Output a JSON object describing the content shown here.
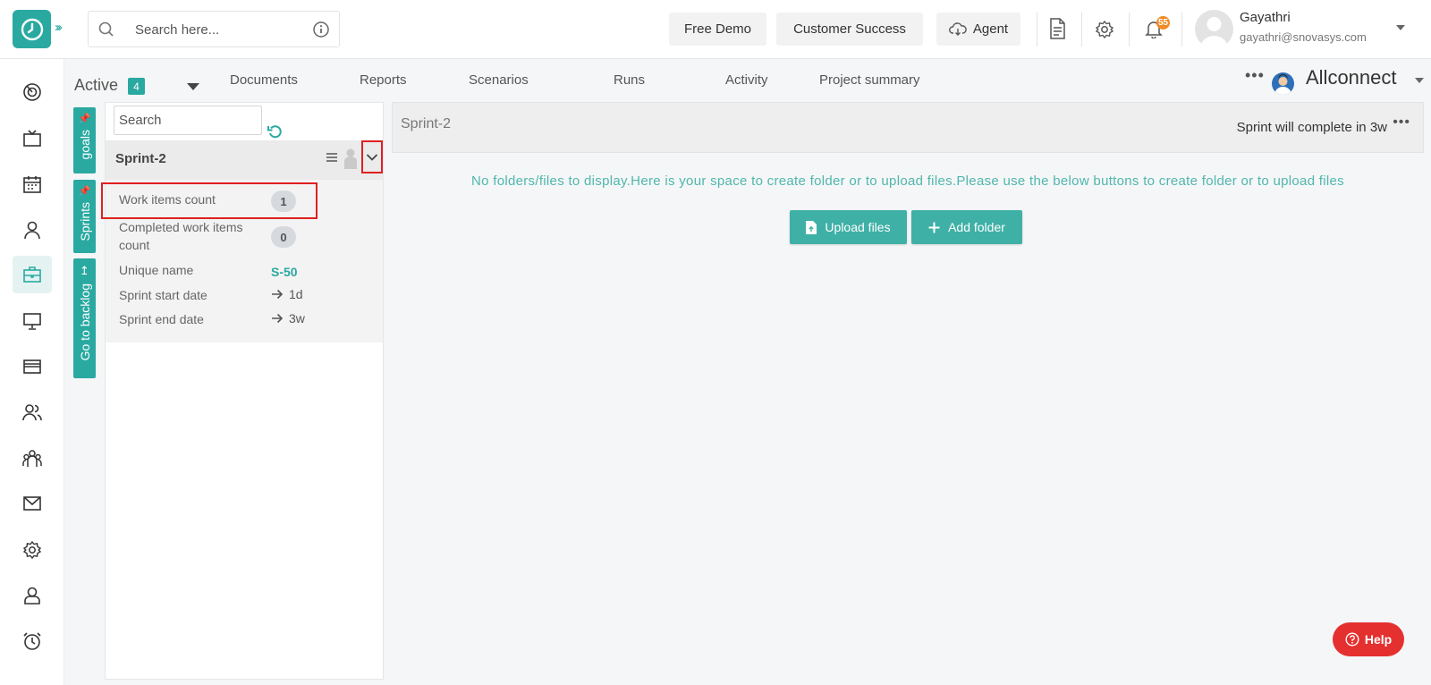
{
  "header": {
    "search_placeholder": "Search here...",
    "buttons": {
      "free_demo": "Free Demo",
      "customer_success": "Customer Success",
      "agent": "Agent"
    },
    "notification_count": "55",
    "user": {
      "name": "Gayathri",
      "email": "gayathri@snovasys.com"
    }
  },
  "left_nav": {
    "icons": [
      "dashboard-icon",
      "tv-icon",
      "calendar-icon",
      "user-icon",
      "briefcase-icon",
      "monitor-icon",
      "card-icon",
      "users-icon",
      "team-icon",
      "mail-icon",
      "settings-icon",
      "profile-icon",
      "alarm-icon"
    ],
    "active_index": 4
  },
  "subheader": {
    "filter_label": "Active",
    "filter_count": "4",
    "tabs": [
      "Documents",
      "Reports",
      "Scenarios",
      "Runs",
      "Activity",
      "Project summary"
    ],
    "project_name": "Allconnect"
  },
  "vertical_tabs": [
    "goals",
    "Sprints",
    "Go to backlog"
  ],
  "sprint_panel": {
    "search_placeholder": "Search",
    "sprint": {
      "title": "Sprint-2",
      "work_items_label": "Work items count",
      "work_items_value": "1",
      "completed_label": "Completed work items count",
      "completed_value": "0",
      "unique_name_label": "Unique name",
      "unique_name_value": "S-50",
      "start_label": "Sprint start date",
      "start_value": "1d",
      "end_label": "Sprint end date",
      "end_value": "3w"
    }
  },
  "main": {
    "title": "Sprint-2",
    "status": "Sprint will complete in 3w",
    "empty_message": "No folders/files to display.Here is your space to create folder or to upload files.Please use the below buttons to create folder or to upload files",
    "upload_label": "Upload files",
    "add_folder_label": "Add folder"
  },
  "help_label": "Help",
  "colors": {
    "accent": "#2aa9a1",
    "highlight": "#e02020",
    "help": "#e53030",
    "badge": "#f08a24"
  }
}
